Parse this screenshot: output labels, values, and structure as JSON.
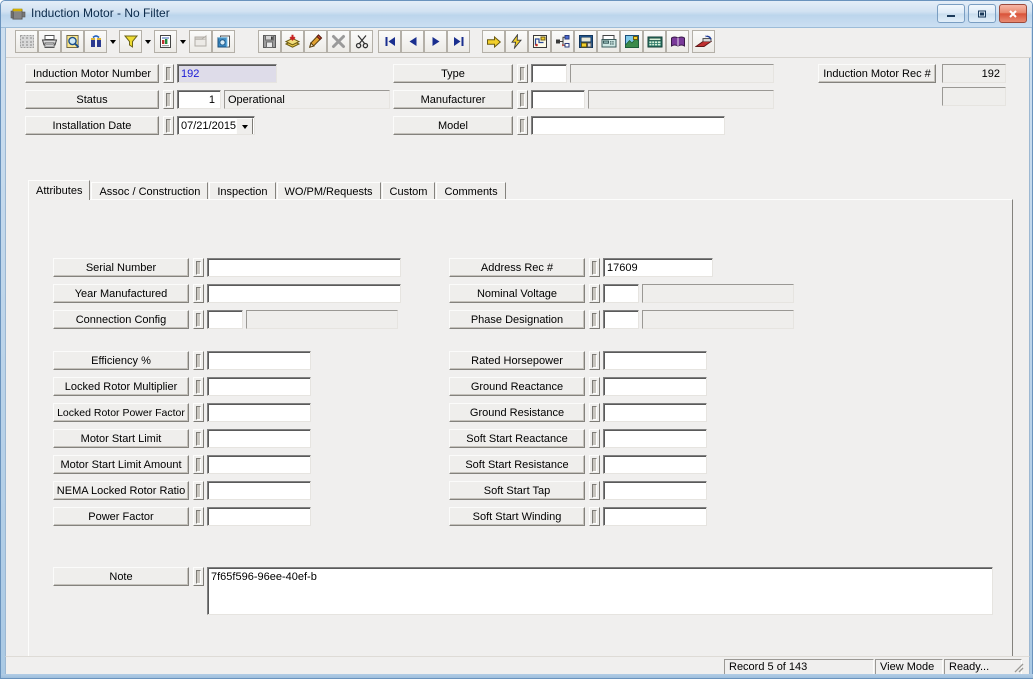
{
  "window": {
    "title": "Induction Motor - No Filter",
    "icon": "motor-icon",
    "minimize_label": "–",
    "restore_label": "❑",
    "close_label": "✕"
  },
  "toolbar": {
    "groups": [
      {
        "buttons": [
          {
            "name": "grid-view-button",
            "icon": "grid-icon",
            "framed": true,
            "disabled": true
          },
          {
            "name": "print-button",
            "icon": "printer-icon",
            "framed": true,
            "disabled": false
          },
          {
            "name": "print-preview-button",
            "icon": "preview-icon",
            "framed": true,
            "disabled": false
          },
          {
            "name": "find-button",
            "icon": "binoculars-icon",
            "framed": true,
            "disabled": false,
            "dropdown": true
          },
          {
            "name": "filter-button",
            "icon": "funnel-icon",
            "framed": true,
            "disabled": false,
            "dropdown": true
          },
          {
            "name": "report-button",
            "icon": "document-icon",
            "framed": true,
            "disabled": false,
            "dropdown": true
          },
          {
            "name": "properties-button",
            "icon": "window-props-icon",
            "framed": true,
            "disabled": true
          },
          {
            "name": "copy-record-button",
            "icon": "copy-records-icon",
            "framed": true,
            "disabled": false
          }
        ]
      },
      {
        "buttons": [
          {
            "name": "save-button",
            "icon": "floppy-icon",
            "framed": true,
            "disabled": true
          },
          {
            "name": "add-record-button",
            "icon": "add-layers-icon",
            "framed": true,
            "disabled": false
          },
          {
            "name": "edit-record-button",
            "icon": "pencil-icon",
            "framed": true,
            "disabled": false
          },
          {
            "name": "delete-record-button",
            "icon": "delete-x-icon",
            "framed": true,
            "disabled": true
          },
          {
            "name": "cut-button",
            "icon": "scissors-icon",
            "framed": true,
            "disabled": false
          }
        ]
      },
      {
        "buttons": [
          {
            "name": "first-record-button",
            "icon": "first-record-icon",
            "framed": true,
            "disabled": false
          },
          {
            "name": "previous-record-button",
            "icon": "prev-record-icon",
            "framed": true,
            "disabled": false
          },
          {
            "name": "next-record-button",
            "icon": "next-record-icon",
            "framed": true,
            "disabled": false
          },
          {
            "name": "last-record-button",
            "icon": "last-record-icon",
            "framed": true,
            "disabled": false
          }
        ]
      },
      {
        "buttons": [
          {
            "name": "goto-button",
            "icon": "yellow-arrow-icon",
            "framed": true,
            "disabled": false
          },
          {
            "name": "quick-action-button",
            "icon": "lightning-icon",
            "framed": true,
            "disabled": false
          },
          {
            "name": "diagram-button",
            "icon": "schematic-icon",
            "framed": true,
            "disabled": false
          },
          {
            "name": "hierarchy-button",
            "icon": "tree-nodes-icon",
            "framed": true,
            "disabled": false
          },
          {
            "name": "workorder-button",
            "icon": "monitor-disk-icon",
            "framed": true,
            "disabled": false
          },
          {
            "name": "fax-button",
            "icon": "fax-machine-icon",
            "framed": true,
            "disabled": false
          },
          {
            "name": "chart-button",
            "icon": "chart-image-icon",
            "framed": true,
            "disabled": false
          },
          {
            "name": "calculator-button",
            "icon": "calculator-icon",
            "framed": true,
            "disabled": false
          },
          {
            "name": "help-book-button",
            "icon": "purple-book-icon",
            "framed": true,
            "disabled": false
          }
        ]
      },
      {
        "buttons": [
          {
            "name": "exit-button",
            "icon": "exit-door-icon",
            "framed": true,
            "disabled": false
          }
        ]
      }
    ]
  },
  "header": {
    "left_rows": [
      {
        "label": "Induction Motor Number",
        "value": "192",
        "style": "key"
      },
      {
        "label": "Status",
        "code": "1",
        "value": "Operational",
        "style": "lookup"
      },
      {
        "label": "Installation Date",
        "value": "07/21/2015",
        "style": "date"
      }
    ],
    "right_rows": [
      {
        "label": "Type",
        "code": "",
        "value": "",
        "style": "lookup"
      },
      {
        "label": "Manufacturer",
        "code": "",
        "value": "",
        "style": "lookup"
      },
      {
        "label": "Model",
        "value": "",
        "style": "text"
      }
    ],
    "rec_label": "Induction Motor Rec #",
    "rec_value": "192",
    "rec_extra_value": ""
  },
  "tabs": [
    {
      "label": "Attributes",
      "active": true
    },
    {
      "label": "Assoc / Construction",
      "active": false
    },
    {
      "label": "Inspection",
      "active": false
    },
    {
      "label": "WO/PM/Requests",
      "active": false
    },
    {
      "label": "Custom",
      "active": false
    },
    {
      "label": "Comments",
      "active": false
    }
  ],
  "attributes": {
    "left_group_a": [
      {
        "label": "Serial Number",
        "value": "",
        "style": "text"
      },
      {
        "label": "Year Manufactured",
        "value": "",
        "style": "text"
      },
      {
        "label": "Connection Config",
        "code": "",
        "value": "",
        "style": "lookup"
      }
    ],
    "left_group_b": [
      {
        "label": "Efficiency %",
        "value": ""
      },
      {
        "label": "Locked Rotor Multiplier",
        "value": ""
      },
      {
        "label": "Locked Rotor Power Factor",
        "value": ""
      },
      {
        "label": "Motor Start Limit",
        "value": ""
      },
      {
        "label": "Motor Start Limit Amount",
        "value": ""
      },
      {
        "label": "NEMA Locked Rotor Ratio",
        "value": ""
      },
      {
        "label": "Power Factor",
        "value": ""
      }
    ],
    "right_group_a": [
      {
        "label": "Address Rec #",
        "value": "17609",
        "style": "text"
      },
      {
        "label": "Nominal Voltage",
        "code": "",
        "value": "",
        "style": "lookup"
      },
      {
        "label": "Phase Designation",
        "code": "",
        "value": "",
        "style": "lookup"
      }
    ],
    "right_group_b": [
      {
        "label": "Rated Horsepower",
        "value": ""
      },
      {
        "label": "Ground Reactance",
        "value": ""
      },
      {
        "label": "Ground Resistance",
        "value": ""
      },
      {
        "label": "Soft Start Reactance",
        "value": ""
      },
      {
        "label": "Soft Start Resistance",
        "value": ""
      },
      {
        "label": "Soft Start Tap",
        "value": ""
      },
      {
        "label": "Soft Start Winding",
        "value": ""
      }
    ],
    "note": {
      "label": "Note",
      "value": "7f65f596-96ee-40ef-b"
    }
  },
  "statusbar": {
    "record": "Record 5 of 143",
    "mode": "View Mode",
    "state": "Ready..."
  },
  "colors": {
    "face": "#f0efee",
    "key_field_bg": "#dedce9",
    "key_field_text": "#1a1ad6",
    "title_text": "#0b2a4a",
    "close_button": "#d9533a"
  }
}
